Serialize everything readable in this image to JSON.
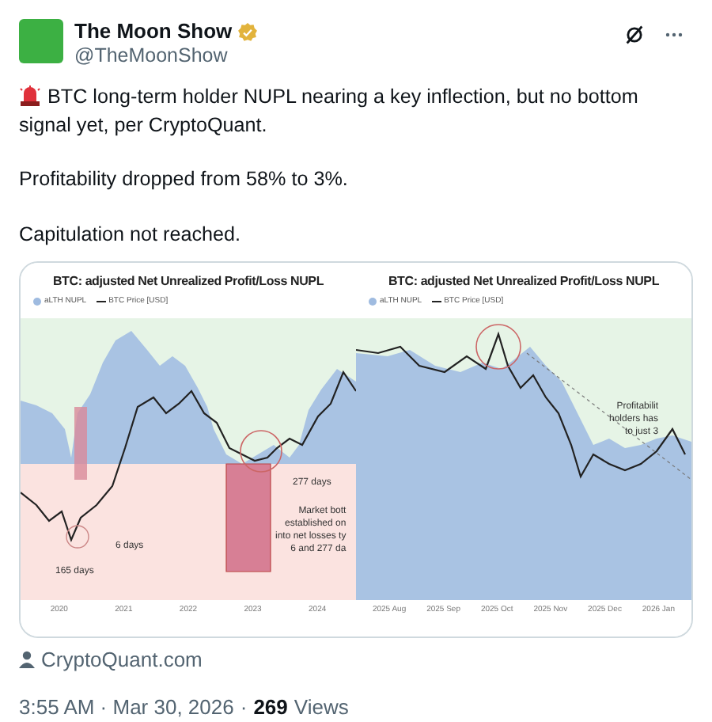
{
  "post": {
    "author": {
      "name": "The Moon Show",
      "handle": "@TheMoonShow",
      "verified": true
    },
    "paragraphs": [
      "BTC long-term holder NUPL nearing a key inflection, but no bottom signal yet, per CryptoQuant.",
      "Profitability dropped from 58% to 3%.",
      "Capitulation not reached."
    ],
    "alert_first": true,
    "charts": [
      {
        "title": "BTC: adjusted Net Unrealized Profit/Loss NUPL",
        "legend": [
          {
            "label": "aLTH NUPL",
            "kind": "dot",
            "color": "#9fbbe0"
          },
          {
            "label": "BTC Price [USD]",
            "kind": "line",
            "color": "#222222"
          }
        ],
        "annotations": [
          "277 days",
          "6 days",
          "165 days",
          "Market bott\nestablished on\ninto net losses ty\n6 and 277 da"
        ],
        "x_labels": [
          "2020",
          "2021",
          "2022",
          "2023",
          "2024"
        ]
      },
      {
        "title": "BTC: adjusted Net Unrealized Profit/Loss NUPL",
        "legend": [
          {
            "label": "aLTH NUPL",
            "kind": "dot",
            "color": "#9fbbe0"
          },
          {
            "label": "BTC Price [USD]",
            "kind": "line",
            "color": "#222222"
          }
        ],
        "annotations": [
          "Profitabilit\nholders has\nto just 3"
        ],
        "x_labels": [
          "2025 Aug",
          "2025 Sep",
          "2025 Oct",
          "2025 Nov",
          "2025 Dec",
          "2026 Jan"
        ]
      }
    ],
    "source": "CryptoQuant.com",
    "time": "3:55 AM · Mar 30, 2026",
    "separator": "·",
    "views_count": "269",
    "views_label": "Views"
  }
}
